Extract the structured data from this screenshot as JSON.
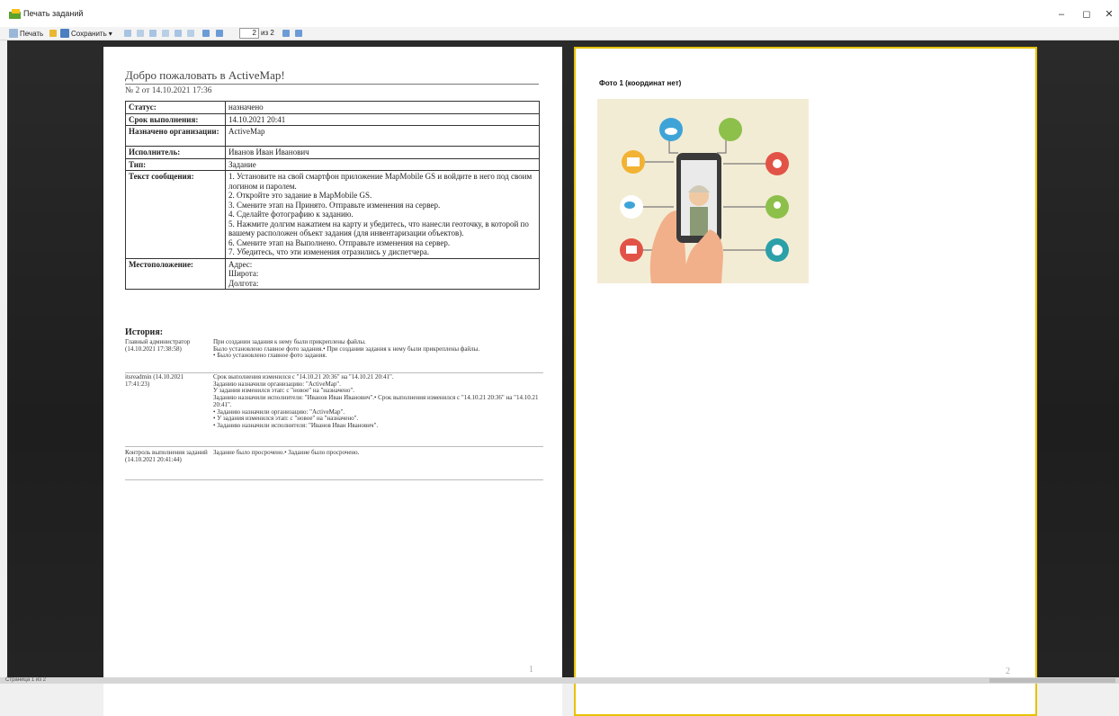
{
  "window": {
    "title": "Печать заданий",
    "minimize": "–",
    "maximize": "◻",
    "close": "✕"
  },
  "toolbar": {
    "print_label": "Печать",
    "save_label": "Сохранить",
    "page_current": "2",
    "page_of": "из 2"
  },
  "page1": {
    "title": "Добро пожаловать в ActiveMap!",
    "subtitle": "№ 2 от 14.10.2021 17:36",
    "rows": [
      {
        "key": "Статус:",
        "value": "назначено"
      },
      {
        "key": "Срок выполнения:",
        "value": "14.10.2021 20:41"
      },
      {
        "key": "Назначено организации:",
        "value": "ActiveMap"
      },
      {
        "key": "Исполнитель:",
        "value": "Иванов Иван Иванович"
      },
      {
        "key": "Тип:",
        "value": "Задание"
      },
      {
        "key": "Текст сообщения:",
        "lines": [
          "1. Установите на свой смартфон приложение MapMobile GS и войдите в него под своим логином и паролем.",
          "2. Откройте это задание в MapMobile GS.",
          "3. Смените этап на Принято. Отправьте изменения на сервер.",
          "4. Сделайте фотографию к заданию.",
          "5. Нажмите долгим нажатием на карту и убедитесь, что нанесли геоточку, в которой по вашему расположен объект задания (для инвентаризации объектов).",
          "6. Смените этап на Выполнено. Отправьте изменения на сервер.",
          "7. Убедитесь, что эти изменения отразились у диспетчера."
        ]
      },
      {
        "key": "Местоположение:",
        "lines": [
          "Адрес:",
          "Широта:",
          "Долгота:"
        ]
      }
    ],
    "history_title": "История:",
    "history": [
      {
        "who": "Главный администратор (14.10.2021 17:38:58)",
        "what": [
          "При создании задания к нему были прикреплены файлы.",
          "Было установлено главное фото задания.• При создании задания к нему были прикреплены файлы.",
          "• Было установлено главное фото задания."
        ]
      },
      {
        "who": "itsreadmin (14.10.2021 17:41:23)",
        "what": [
          "Срок выполнения изменился с \"14.10.21 20:36\" на \"14.10.21 20:41\".",
          "Заданию назначили организацию: \"ActiveMap\".",
          "У задания изменился этап: с \"новое\" на \"назначено\".",
          "Заданию назначили исполнителя: \"Иванов Иван Иванович\".• Срок выполнения изменился с \"14.10.21 20:36\" на \"14.10.21 20:41\".",
          "• Заданию назначили организацию: \"ActiveMap\".",
          "• У задания изменился этап: с \"новое\" на \"назначено\".",
          "• Заданию назначили исполнителя: \"Иванов Иван Иванович\"."
        ]
      },
      {
        "who": "Контроль выполнения заданий (14.10.2021 20:41:44)",
        "what": [
          "Задание было просрочено.• Задание было просрочено."
        ]
      }
    ],
    "page_number": "1"
  },
  "page2": {
    "photo_title": "Фото 1 (координат нет)",
    "page_number": "2"
  },
  "status": {
    "text": "Страница 1 из 2"
  }
}
